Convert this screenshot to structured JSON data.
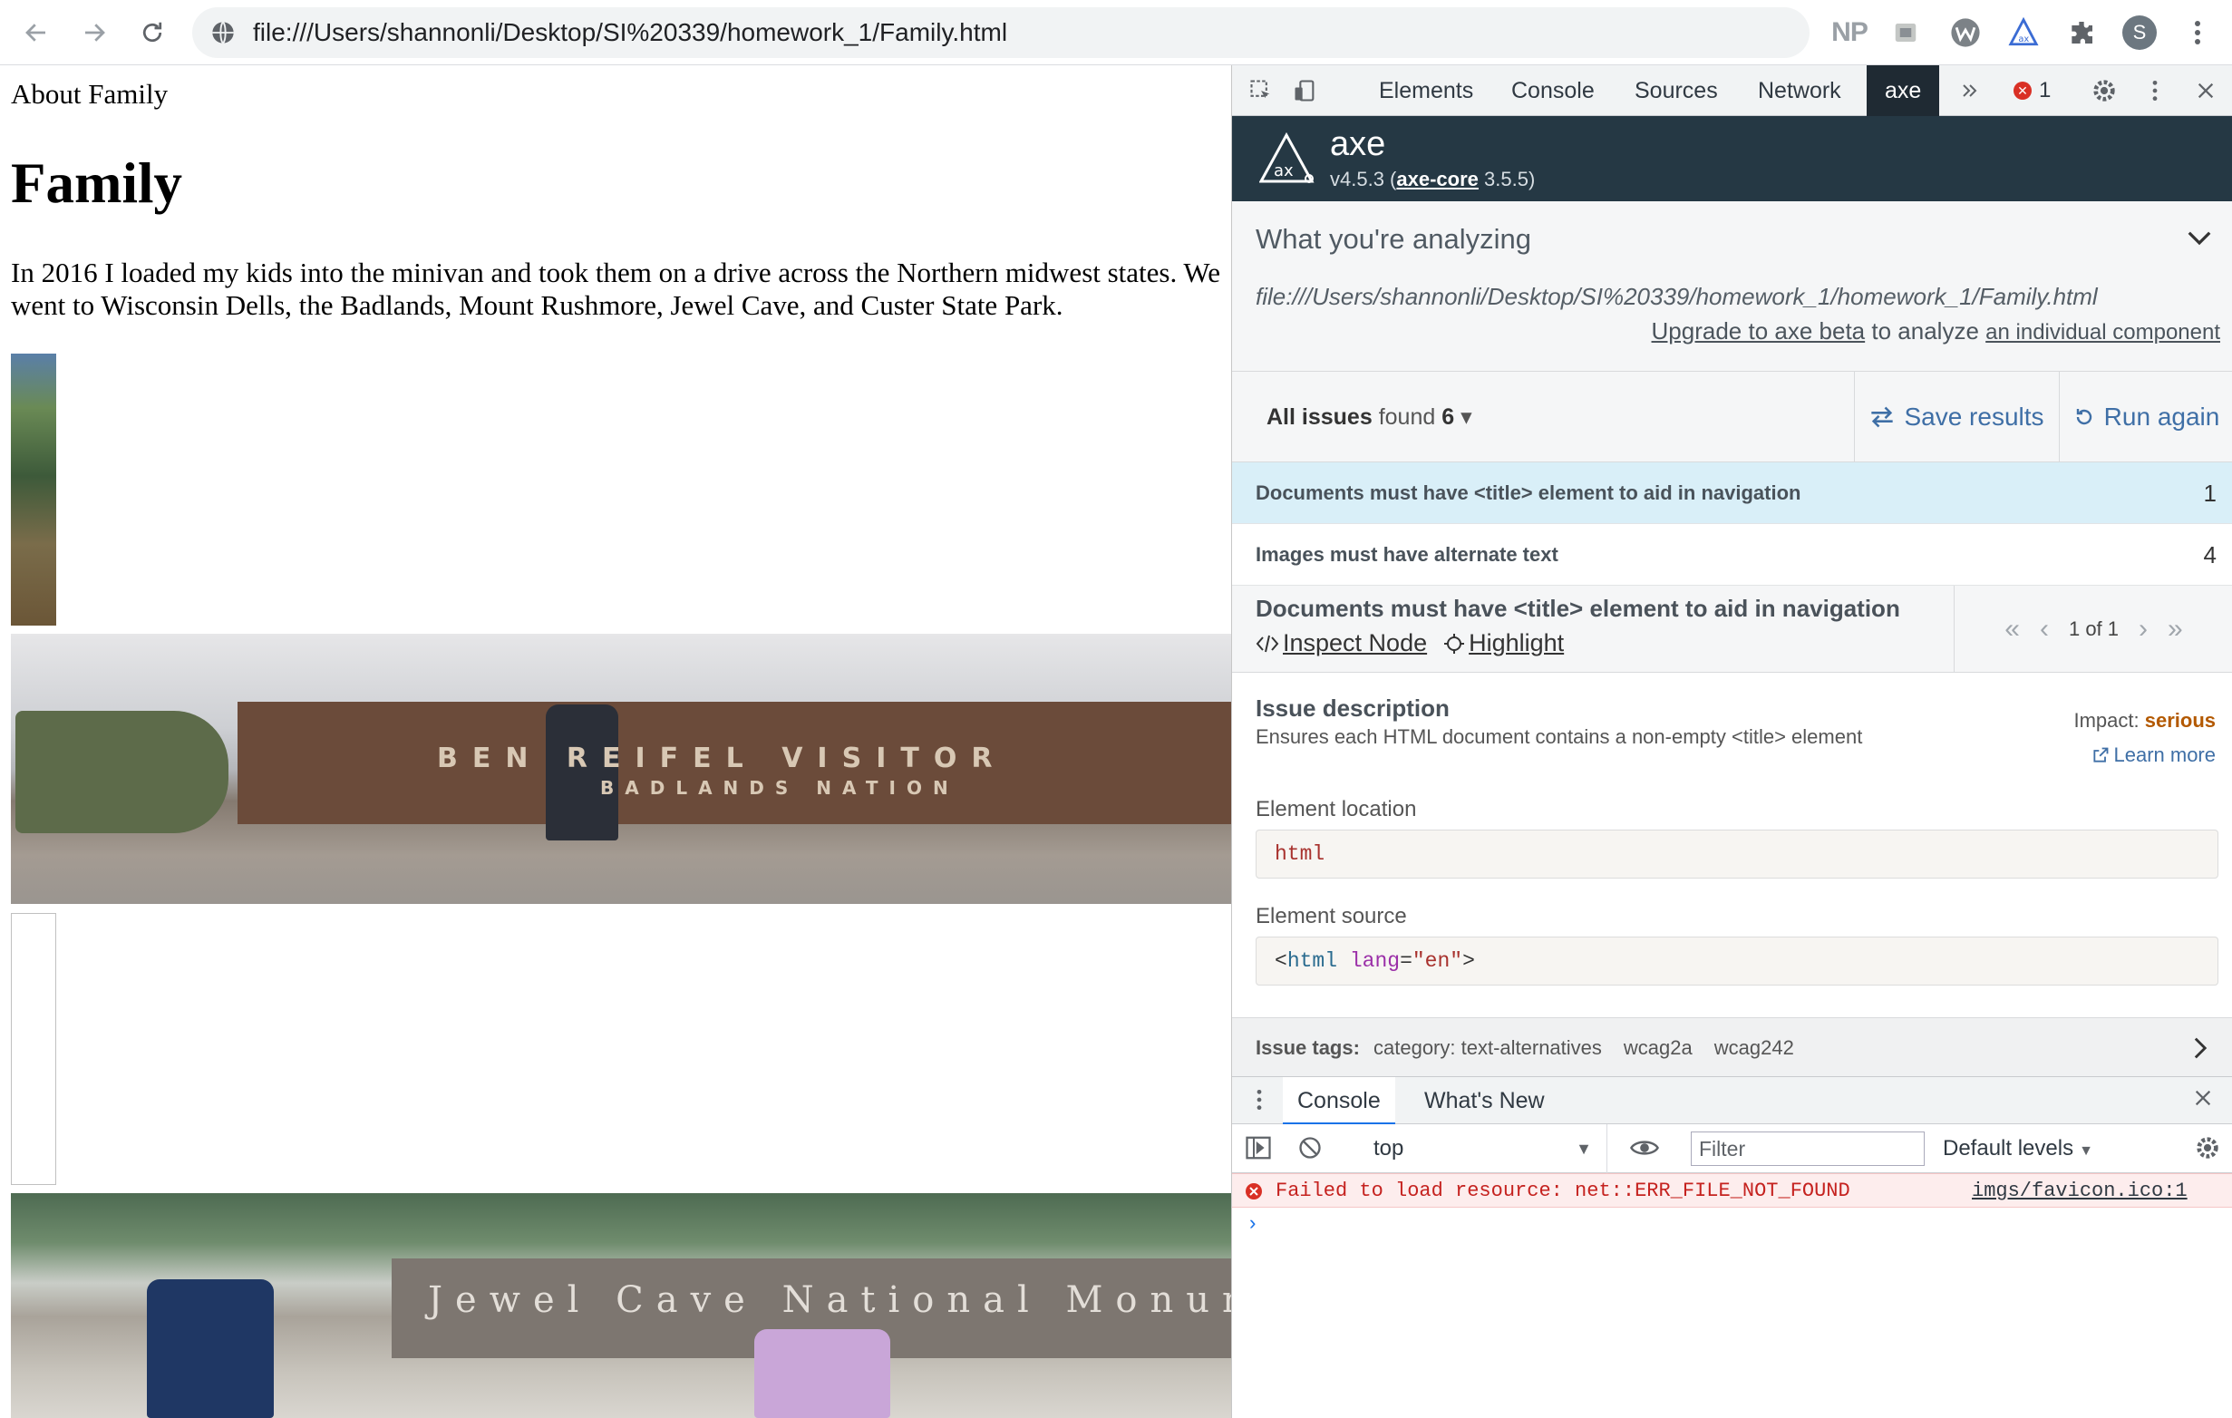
{
  "browser": {
    "url": "file:///Users/shannonli/Desktop/SI%20339/homework_1/Family.html",
    "extensions": {
      "np_label": "NP",
      "avatar_initial": "S"
    }
  },
  "page": {
    "nav_link": "About Family",
    "heading": "Family",
    "paragraph": "In 2016 I loaded my kids into the minivan and took them on a drive across the Northern midwest states. We went to Wisconsin Dells, the Badlands, Mount Rushmore, Jewel Cave, and Custer State Park.",
    "photo2_sign": {
      "line1": "BEN REIFEL VISITOR",
      "line2": "BADLANDS NATION"
    },
    "photo4_sign": {
      "line1": "Jewel Cave National Monum"
    }
  },
  "devtools": {
    "tabs": [
      "Elements",
      "Console",
      "Sources",
      "Network",
      "axe"
    ],
    "active_tab": "axe",
    "error_count": "1",
    "axe": {
      "name": "axe",
      "version": "v4.5.3",
      "core_link": "axe-core",
      "core_version": "3.5.5",
      "analyzing_title": "What you're analyzing",
      "analyzing_url": "file:///Users/shannonli/Desktop/SI%20339/homework_1/homework_1/Family.html",
      "upgrade_link": "Upgrade to axe beta",
      "upgrade_middle": "to analyze",
      "upgrade_component": "an individual component",
      "issues_label": "All issues",
      "issues_found": "found",
      "issues_count": "6",
      "save_results": "Save results",
      "run_again": "Run again",
      "issue_rows": [
        {
          "label": "Documents must have <title> element to aid in navigation",
          "count": "1"
        },
        {
          "label": "Images must have alternate text",
          "count": "4"
        }
      ],
      "detail": {
        "title": "Documents must have <title> element to aid in navigation",
        "inspect_node": "Inspect Node",
        "highlight": "Highlight",
        "pager": "1 of 1",
        "desc_title": "Issue description",
        "desc_text": "Ensures each HTML document contains a non-empty <title> element",
        "impact_label": "Impact:",
        "impact_value": "serious",
        "learn_more": "Learn more",
        "location_label": "Element location",
        "location_value": "html",
        "source_label": "Element source",
        "source": {
          "open": "<",
          "tag": "html",
          "attr": "lang",
          "eq": "=",
          "val": "\"en\"",
          "close": ">"
        },
        "tags_label": "Issue tags:",
        "tags": [
          "category: text-alternatives",
          "wcag2a",
          "wcag242"
        ]
      }
    },
    "drawer": {
      "tabs": [
        "Console",
        "What's New"
      ],
      "context": "top",
      "filter_placeholder": "Filter",
      "levels": "Default levels",
      "error_message": "Failed to load resource: net::ERR_FILE_NOT_FOUND",
      "error_source": "imgs/favicon.ico:1",
      "prompt": "›"
    }
  },
  "colors": {
    "axe_header_bg": "#253844",
    "selected_issue_bg": "#d9eff8",
    "link_blue": "#3f6fa6",
    "impact_serious": "#b35900",
    "console_error": "#c5221f"
  }
}
